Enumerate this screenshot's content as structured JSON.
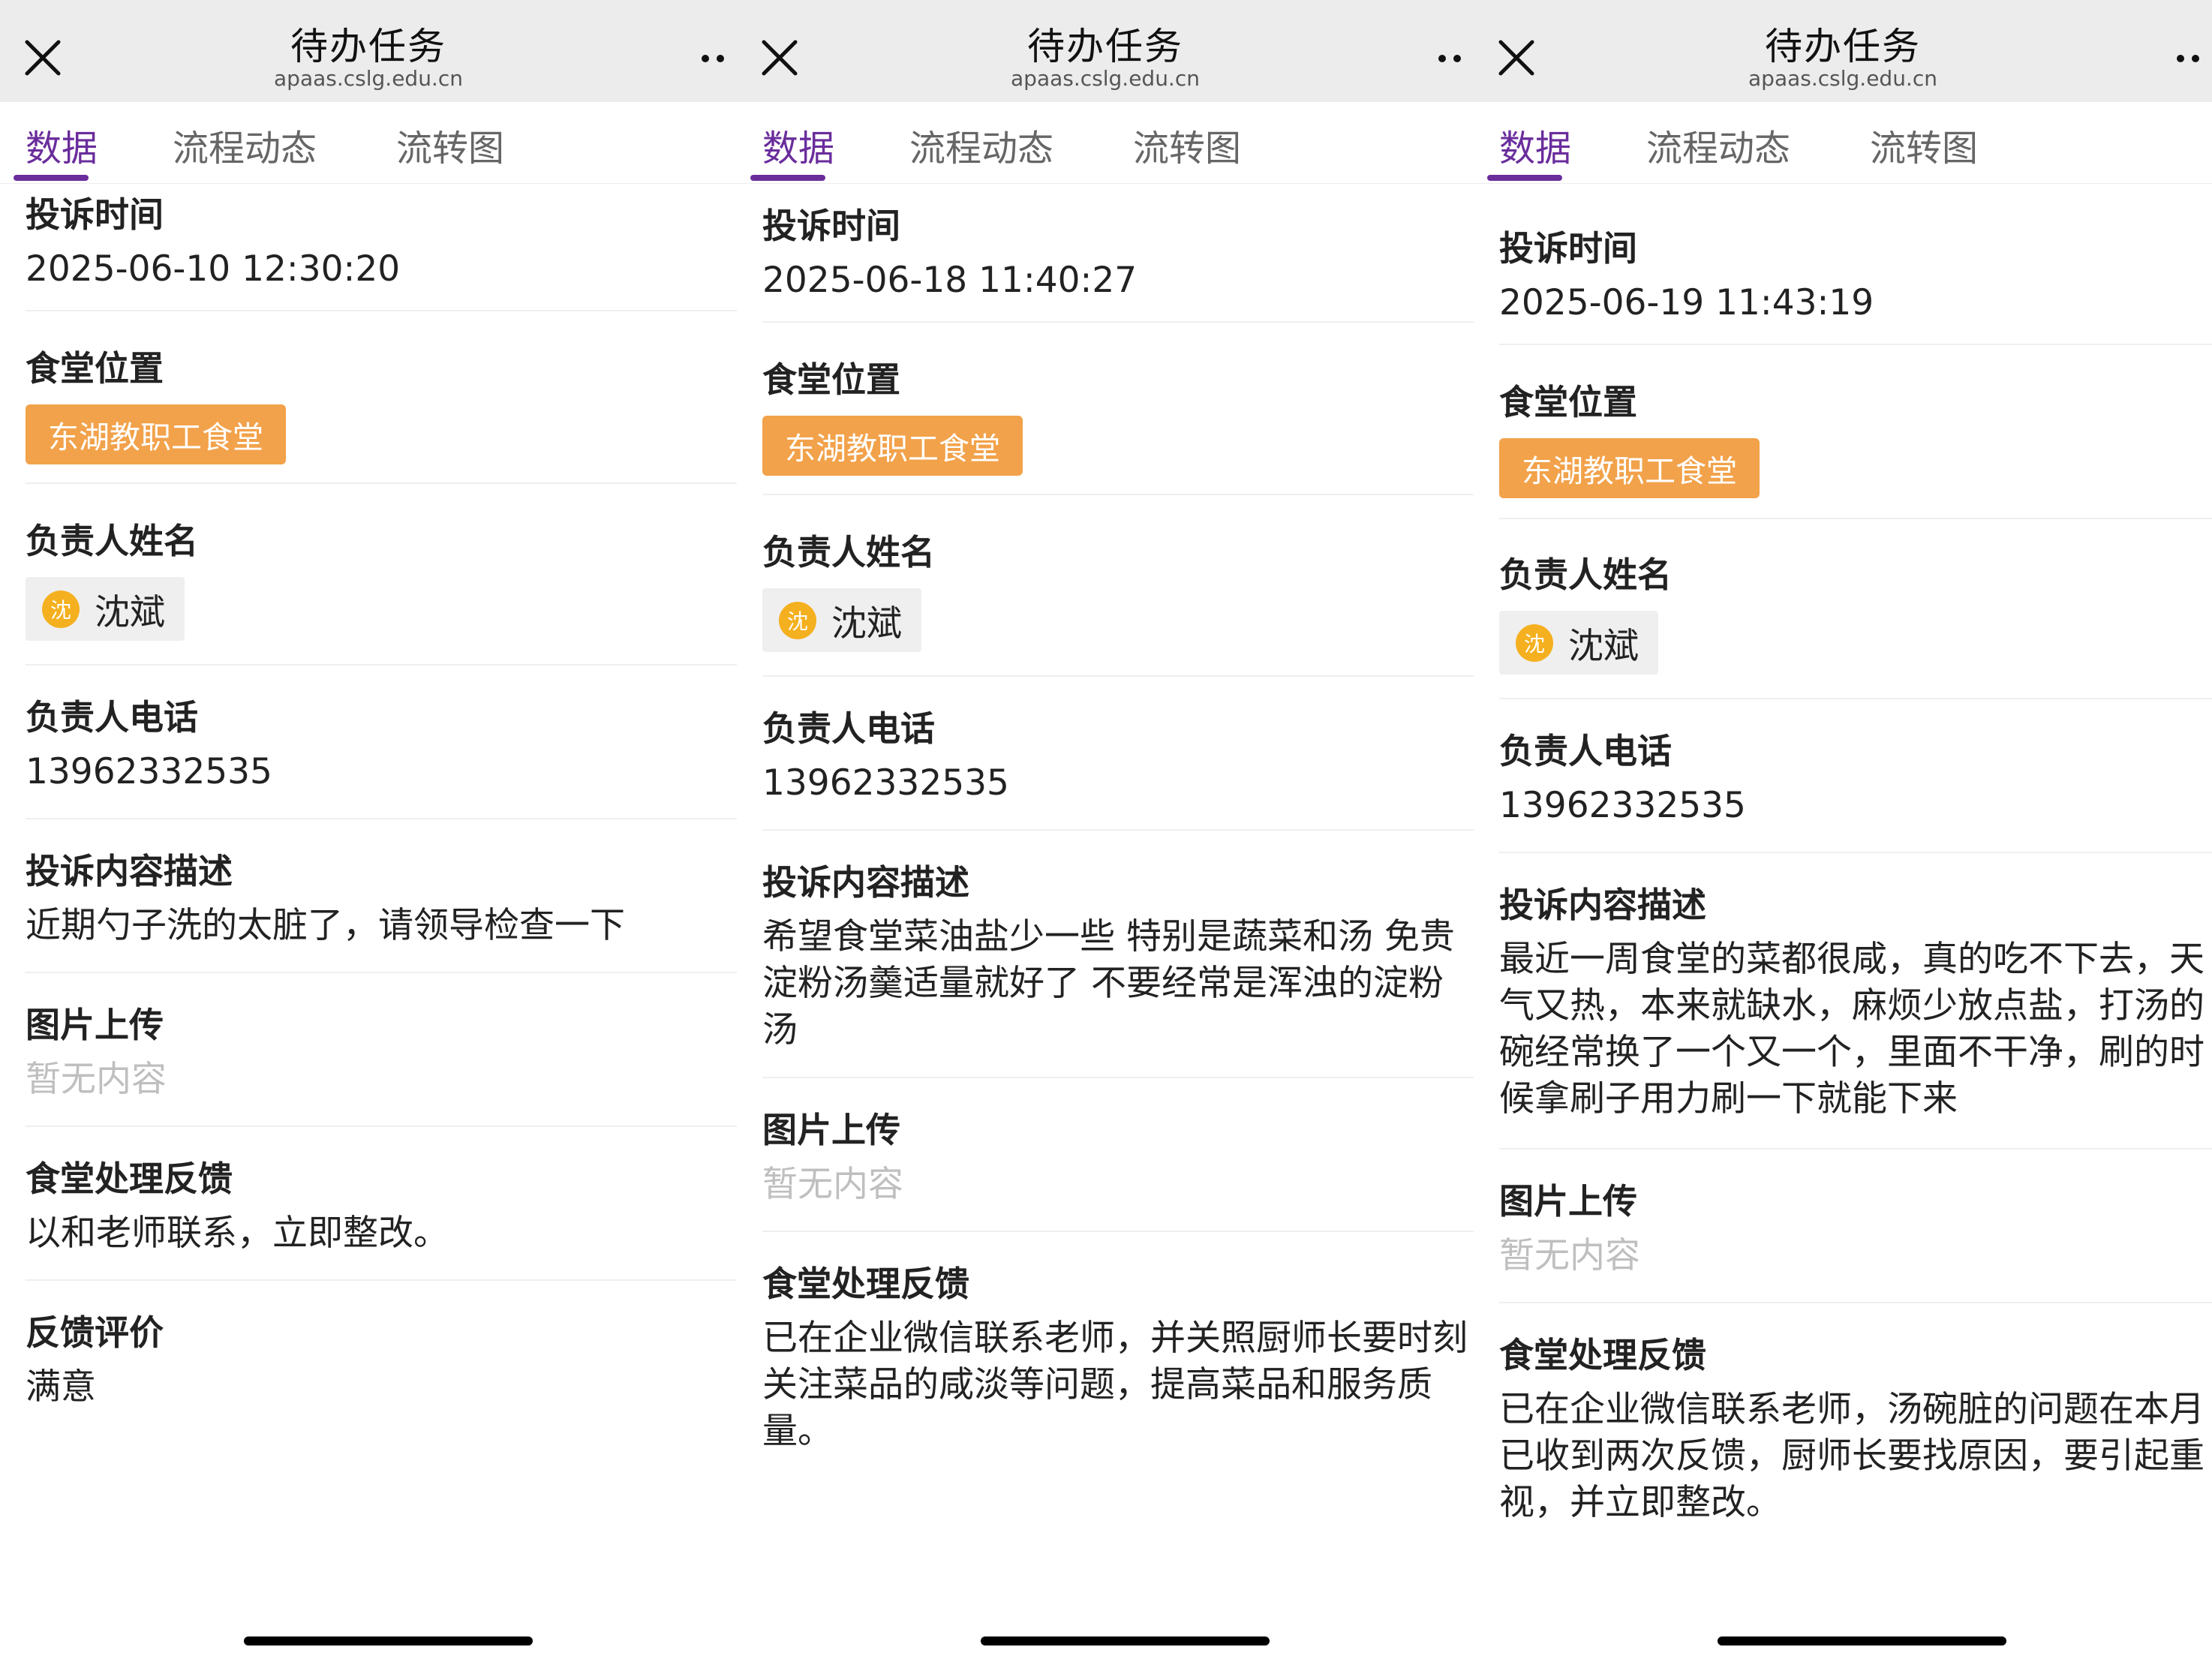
{
  "header": {
    "title": "待办任务",
    "domain": "apaas.cslg.edu.cn"
  },
  "tabs": [
    "数据",
    "流程动态",
    "流转图"
  ],
  "labels": {
    "complaint_time": "投诉时间",
    "canteen_location": "食堂位置",
    "manager_name": "负责人姓名",
    "manager_phone": "负责人电话",
    "complaint_desc": "投诉内容描述",
    "image_upload": "图片上传",
    "canteen_feedback": "食堂处理反馈",
    "feedback_rating": "反馈评价"
  },
  "records": [
    {
      "complaint_time": "2025-06-10 12:30:20",
      "canteen_location": "东湖教职工食堂",
      "manager_avatar": "沈",
      "manager_name": "沈斌",
      "manager_phone": "13962332535",
      "complaint_desc": "近期勺子洗的太脏了，请领导检查一下",
      "image_upload": "暂无内容",
      "canteen_feedback": "以和老师联系，立即整改。",
      "feedback_rating": "满意"
    },
    {
      "complaint_time": "2025-06-18 11:40:27",
      "canteen_location": "东湖教职工食堂",
      "manager_avatar": "沈",
      "manager_name": "沈斌",
      "manager_phone": "13962332535",
      "complaint_desc": "希望食堂菜油盐少一些 特别是蔬菜和汤 免贵淀粉汤羹适量就好了 不要经常是浑浊的淀粉汤",
      "image_upload": "暂无内容",
      "canteen_feedback": "已在企业微信联系老师，并关照厨师长要时刻关注菜品的咸淡等问题，提高菜品和服务质量。"
    },
    {
      "complaint_time": "2025-06-19 11:43:19",
      "canteen_location": "东湖教职工食堂",
      "manager_avatar": "沈",
      "manager_name": "沈斌",
      "manager_phone": "13962332535",
      "complaint_desc": "最近一周食堂的菜都很咸，真的吃不下去，天气又热，本来就缺水，麻烦少放点盐，打汤的碗经常换了一个又一个，里面不干净，刷的时候拿刷子用力刷一下就能下来",
      "image_upload": "暂无内容",
      "canteen_feedback": "已在企业微信联系老师，汤碗脏的问题在本月已收到两次反馈，厨师长要找原因，要引起重视，并立即整改。"
    }
  ],
  "colors": {
    "accent": "#6a2d9c",
    "badge": "#f2a24a",
    "avatar": "#f5b01f",
    "placeholder": "#bfbfbf"
  },
  "icons": {
    "close": "close-icon",
    "more": "more-dots-icon"
  }
}
